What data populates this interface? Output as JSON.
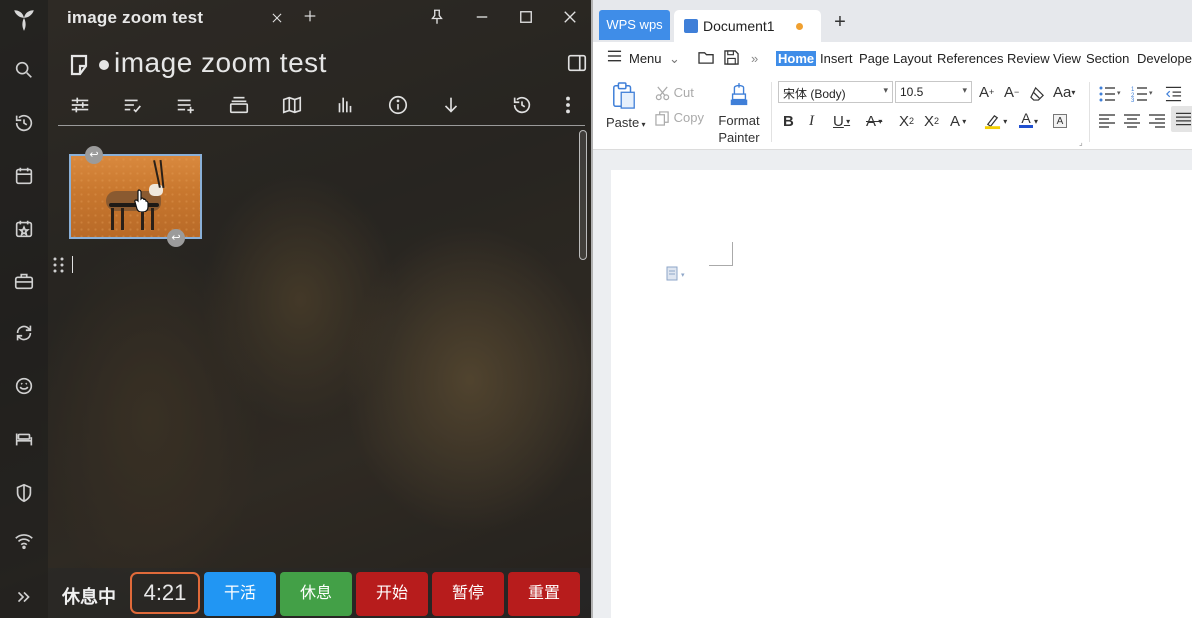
{
  "left_app": {
    "tab_title": "image zoom test",
    "doc_title": "image zoom test",
    "activity_icons": [
      "search-icon",
      "history-icon",
      "calendar-icon",
      "calendar-star-icon",
      "briefcase-icon",
      "sync-icon",
      "emoji-icon",
      "bed-icon",
      "shield-icon",
      "wifi-icon",
      "expand-icon"
    ],
    "toolbar_icons": [
      "sliders-icon",
      "list-check-icon",
      "list-add-icon",
      "stack-icon",
      "map-icon",
      "chart-icon",
      "info-icon",
      "arrow-down-icon",
      "history-icon",
      "more-icon"
    ],
    "status_label": "休息中",
    "timer": "4:21",
    "buttons": [
      {
        "label": "干活",
        "color": "#2196f3"
      },
      {
        "label": "休息",
        "color": "#43a047"
      },
      {
        "label": "开始",
        "color": "#b71c1c"
      },
      {
        "label": "暂停",
        "color": "#b71c1c"
      },
      {
        "label": "重置",
        "color": "#b71c1c"
      }
    ]
  },
  "wps": {
    "brand_tab": "WPS wps",
    "doc_tab_title": "Document1",
    "new_tab": "+",
    "menu": {
      "menu_label": "Menu",
      "tabs": [
        "Home",
        "Insert",
        "Page Layout",
        "References",
        "Review",
        "View",
        "Section",
        "Develope"
      ]
    },
    "clipboard": {
      "paste": "Paste",
      "cut": "Cut",
      "copy": "Copy",
      "format_painter_1": "Format",
      "format_painter_2": "Painter"
    },
    "font": {
      "name": "宋体 (Body)",
      "size": "10.5"
    },
    "accent_color": "#3f8de8"
  }
}
